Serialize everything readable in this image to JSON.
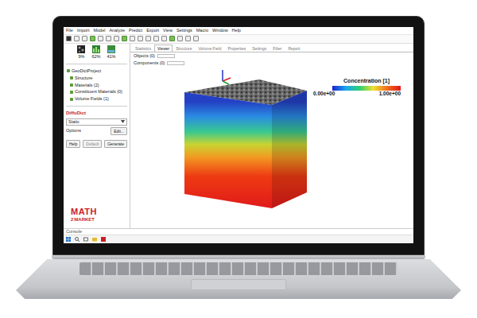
{
  "menu": [
    "File",
    "Import",
    "Model",
    "Analyze",
    "Predict",
    "Export",
    "View",
    "Settings",
    "Macro",
    "Window",
    "Help"
  ],
  "stats": [
    {
      "reading": "9%"
    },
    {
      "reading": "62%"
    },
    {
      "reading": "41%"
    }
  ],
  "tree": [
    "GeoDictProject",
    "Structure",
    "Materials (2)",
    "Constituent Materials (0)",
    "Volume Fields (1)"
  ],
  "panel": {
    "title": "DiffuDict",
    "select": "Static",
    "options_label": "Options",
    "edit_button": "Edit...",
    "buttons": [
      {
        "label": "Help",
        "disabled": false
      },
      {
        "label": "Default",
        "disabled": true
      },
      {
        "label": "Generate",
        "disabled": false
      }
    ]
  },
  "logo": {
    "line1": "MATH",
    "digit": "2",
    "line2": "MARKET"
  },
  "tabs": [
    {
      "label": "Statistics",
      "selected": false
    },
    {
      "label": "Viewer",
      "selected": true
    },
    {
      "label": "Structure",
      "selected": false
    },
    {
      "label": "Volume Field",
      "selected": false
    },
    {
      "label": "Properties",
      "selected": false
    },
    {
      "label": "Settings",
      "selected": false
    },
    {
      "label": "Filter",
      "selected": false
    },
    {
      "label": "Report",
      "selected": false
    }
  ],
  "fields": [
    "Objects (0)",
    "Components (0)"
  ],
  "legend": {
    "title": "Concentration [1]",
    "min": "0.00e+00",
    "max": "1.00e+00"
  },
  "console": "Console"
}
